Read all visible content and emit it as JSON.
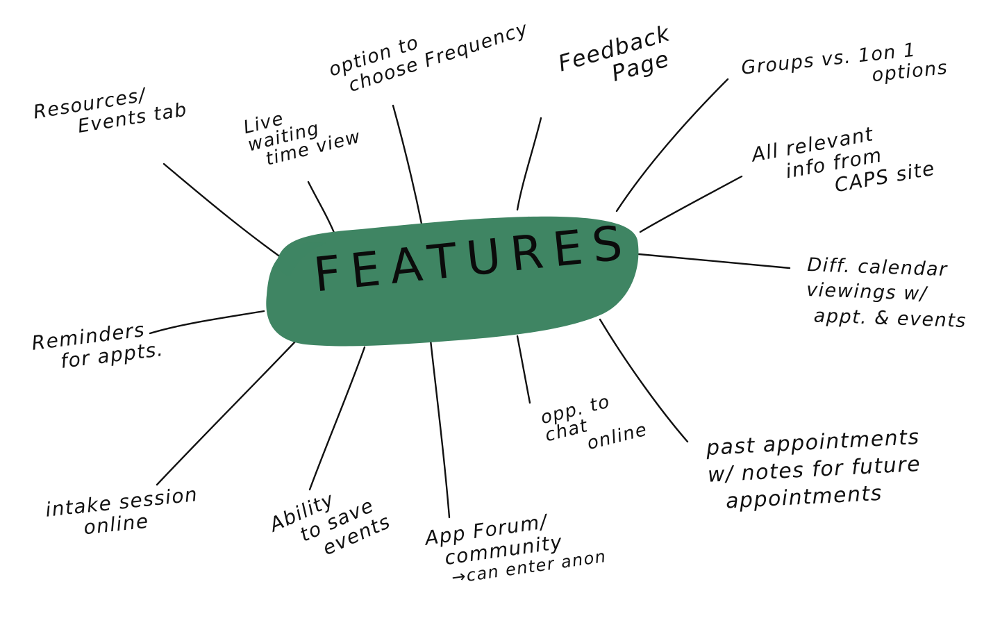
{
  "center": {
    "label": "FEATURES",
    "color": "#3f8563"
  },
  "features": [
    {
      "lines": [
        "Resources/",
        "Events tab"
      ]
    },
    {
      "lines": [
        "Live",
        "waiting",
        "time view"
      ]
    },
    {
      "lines": [
        "option to",
        "choose Frequency"
      ]
    },
    {
      "lines": [
        "Feedback",
        "Page"
      ]
    },
    {
      "lines": [
        "Groups vs. 1on 1",
        "options"
      ]
    },
    {
      "lines": [
        "All relevant",
        "info from",
        "CAPS site"
      ]
    },
    {
      "lines": [
        "Diff. calendar",
        "viewings w/",
        "appt. & events"
      ]
    },
    {
      "lines": [
        "past appointments",
        "w/ notes for future",
        "appointments"
      ]
    },
    {
      "lines": [
        "opp. to",
        "chat",
        "online"
      ]
    },
    {
      "lines": [
        "App Forum/",
        "community",
        "→can enter anon"
      ]
    },
    {
      "lines": [
        "Ability",
        "to save",
        "events"
      ]
    },
    {
      "lines": [
        "intake session",
        "online"
      ]
    },
    {
      "lines": [
        "Reminders",
        "for appts."
      ]
    }
  ]
}
